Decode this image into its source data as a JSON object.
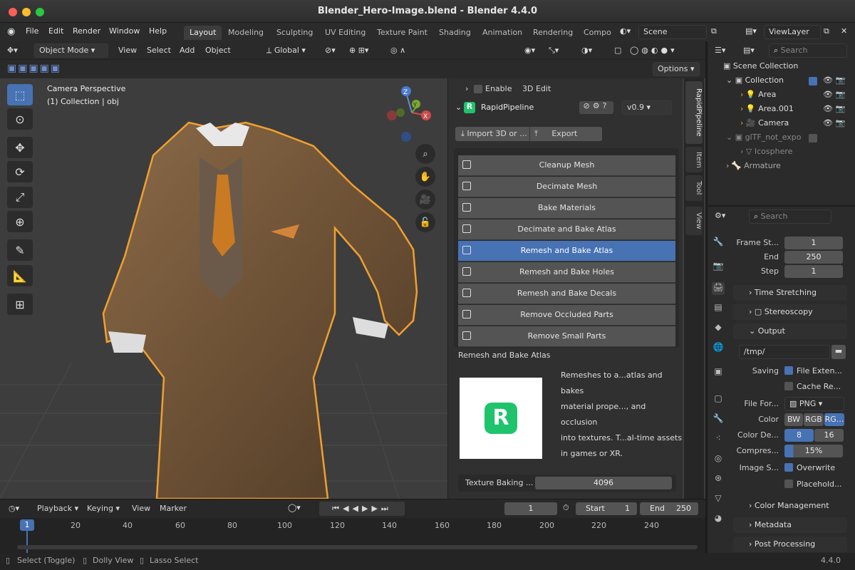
{
  "window": {
    "title": "Blender_Hero-Image.blend - Blender 4.4.0"
  },
  "menu": [
    "File",
    "Edit",
    "Render",
    "Window",
    "Help"
  ],
  "workspaces": [
    "Layout",
    "Modeling",
    "Sculpting",
    "UV Editing",
    "Texture Paint",
    "Shading",
    "Animation",
    "Rendering",
    "Compo"
  ],
  "scene": {
    "name": "Scene",
    "view_layer": "ViewLayer"
  },
  "vp_header": {
    "mode": "Object Mode",
    "view": "View",
    "select": "Select",
    "add": "Add",
    "object": "Object",
    "orientation": "Global",
    "options": "Options"
  },
  "viewport": {
    "camera_label": "Camera Perspective",
    "collection_label": "(1) Collection | obj"
  },
  "npanel": {
    "enable_label": "Enable",
    "edit3d_label": "3D Edit",
    "addon_title": "RapidPipeline",
    "version": "v0.9",
    "import_label": "Import 3D or ...",
    "export_label": "Export",
    "buttons": [
      "Cleanup Mesh",
      "Decimate Mesh",
      "Bake Materials",
      "Decimate and Bake Atlas",
      "Remesh and Bake Atlas",
      "Remesh and Bake Holes",
      "Remesh and Bake Decals",
      "Remove Occluded Parts",
      "Remove Small Parts"
    ],
    "selected_title": "Remesh and Bake Atlas",
    "description": [
      "Remeshes to a...atlas and bakes",
      "material prope..., and occlusion",
      "into textures. T...al-time assets",
      "in games or XR."
    ],
    "texture_label": "Texture Baking ...",
    "texture_value": "4096",
    "side_tabs": [
      "RapidPipeline",
      "Item",
      "Tool",
      "View"
    ]
  },
  "timeline": {
    "playback": "Playback",
    "keying": "Keying",
    "view": "View",
    "marker": "Marker",
    "current_frame": "1",
    "start_label": "Start",
    "start": "1",
    "end_label": "End",
    "end": "250",
    "ticks": [
      "1",
      "20",
      "40",
      "60",
      "80",
      "100",
      "120",
      "140",
      "160",
      "180",
      "200",
      "220",
      "240"
    ]
  },
  "status": {
    "select": "Select (Toggle)",
    "dolly": "Dolly View",
    "lasso": "Lasso Select",
    "version": "4.4.0"
  },
  "outliner": {
    "search": "Search",
    "rows": [
      {
        "label": "Scene Collection"
      },
      {
        "label": "Collection"
      },
      {
        "label": "Area"
      },
      {
        "label": "Area.001"
      },
      {
        "label": "Camera"
      },
      {
        "label": "glTF_not_expo"
      },
      {
        "label": "Icosphere"
      },
      {
        "label": "Armature"
      }
    ]
  },
  "props": {
    "search": "Search",
    "frame_start_label": "Frame St...",
    "frame_start": "1",
    "end_label": "End",
    "end": "250",
    "step_label": "Step",
    "step": "1",
    "time_stretching": "Time Stretching",
    "stereoscopy": "Stereoscopy",
    "output": "Output",
    "path": "/tmp/",
    "saving_label": "Saving",
    "file_ext": "File Exten...",
    "cache_re": "Cache Re...",
    "file_format_label": "File For...",
    "file_format": "PNG",
    "color_label": "Color",
    "color_opts": [
      "BW",
      "RGB",
      "RG..."
    ],
    "depth_label": "Color De...",
    "depth_opts": [
      "8",
      "16"
    ],
    "compress_label": "Compres...",
    "compress": "15%",
    "image_seq_label": "Image S...",
    "overwrite": "Overwrite",
    "placeholder": "Placehold...",
    "color_mgmt": "Color Management",
    "metadata": "Metadata",
    "post_proc": "Post Processing"
  }
}
